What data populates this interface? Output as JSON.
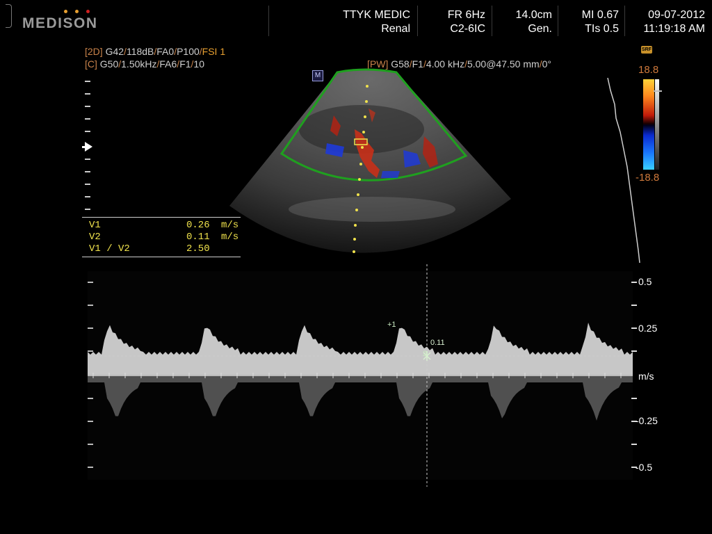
{
  "header": {
    "brand": "MEDISON",
    "brand_dot_colors": [
      "#e8a030",
      "#e8a030",
      "#d02020"
    ],
    "institution": "TTYK MEDIC",
    "preset": "Renal",
    "frame_rate": "FR 6Hz",
    "probe": "C2-6IC",
    "depth": "14.0cm",
    "mode": "Gen.",
    "mi": "MI 0.67",
    "tis": "TIs 0.5",
    "date": "09-07-2012",
    "time": "11:19:18 AM"
  },
  "params": {
    "line1": {
      "tag": "[2D]",
      "values": [
        {
          "text": "G42",
          "color": "#cfcfcf"
        },
        {
          "text": "/",
          "color": "#c8824a"
        },
        {
          "text": "118dB",
          "color": "#cfcfcf"
        },
        {
          "text": "/",
          "color": "#c8824a"
        },
        {
          "text": "FA0",
          "color": "#cfcfcf"
        },
        {
          "text": "/",
          "color": "#c8824a"
        },
        {
          "text": "P100",
          "color": "#cfcfcf"
        },
        {
          "text": "/",
          "color": "#c8824a"
        },
        {
          "text": "FSI 1",
          "color": "#e8a030"
        }
      ]
    },
    "line2": {
      "tag": "[C]",
      "values": [
        {
          "text": "G50",
          "color": "#cfcfcf"
        },
        {
          "text": "/",
          "color": "#c8824a"
        },
        {
          "text": "1.50kHz",
          "color": "#cfcfcf"
        },
        {
          "text": "/",
          "color": "#c8824a"
        },
        {
          "text": "FA6",
          "color": "#cfcfcf"
        },
        {
          "text": "/",
          "color": "#c8824a"
        },
        {
          "text": "F1",
          "color": "#cfcfcf"
        },
        {
          "text": "/",
          "color": "#c8824a"
        },
        {
          "text": "10",
          "color": "#cfcfcf"
        }
      ]
    },
    "line3": {
      "tag": "[PW]",
      "values": [
        {
          "text": "G58",
          "color": "#cfcfcf"
        },
        {
          "text": "/",
          "color": "#c8824a"
        },
        {
          "text": "F1",
          "color": "#cfcfcf"
        },
        {
          "text": "/",
          "color": "#c8824a"
        },
        {
          "text": "4.00 kHz",
          "color": "#cfcfcf"
        },
        {
          "text": "/",
          "color": "#c8824a"
        },
        {
          "text": "5.00@47.50 mm",
          "color": "#cfcfcf"
        },
        {
          "text": "/",
          "color": "#c8824a"
        },
        {
          "text": "0°",
          "color": "#cfcfcf"
        }
      ]
    }
  },
  "measurements": [
    {
      "label": "V1",
      "value": "0.26",
      "unit": "m/s"
    },
    {
      "label": "V2",
      "value": "0.11",
      "unit": "m/s"
    },
    {
      "label": "V1 / V2",
      "value": "2.50",
      "unit": ""
    }
  ],
  "image_marker": "M",
  "color_bar": {
    "icon_label": "SRF",
    "max": "18.8",
    "min": "-18.8"
  },
  "spectrum": {
    "scale_labels": [
      "0.5",
      "0.25",
      "m/s",
      "-0.25",
      "-0.5"
    ],
    "caliper1_label": "+1",
    "caliper2_label": "2",
    "caliper_value": "0.11"
  }
}
